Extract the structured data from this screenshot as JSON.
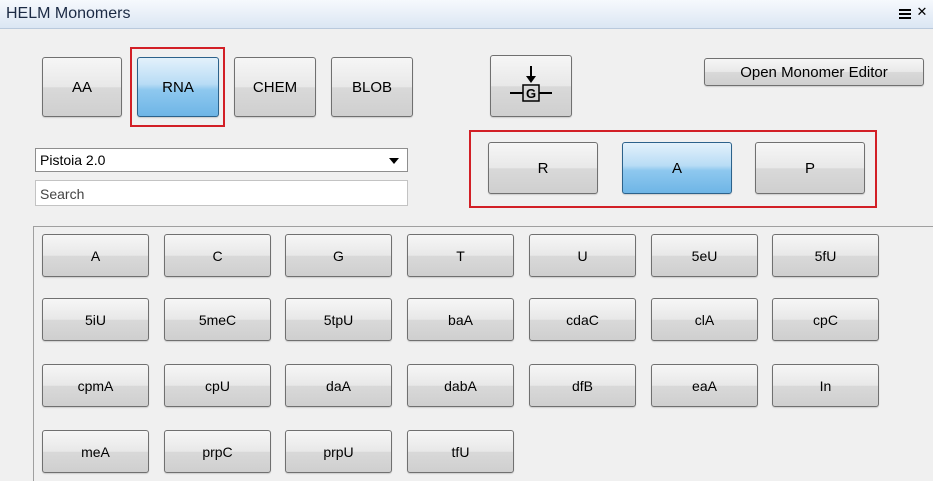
{
  "window": {
    "title": "HELM Monomers"
  },
  "polymer_types": [
    "AA",
    "RNA",
    "CHEM",
    "BLOB"
  ],
  "active_polymer_type": "RNA",
  "insert_icon": "insert-monomer-g-icon",
  "open_editor_label": "Open Monomer Editor",
  "library_select": {
    "value": "Pistoia 2.0"
  },
  "search": {
    "placeholder": "Search"
  },
  "components": [
    "R",
    "A",
    "P"
  ],
  "active_component": "A",
  "monomers": [
    "A",
    "C",
    "G",
    "T",
    "U",
    "5eU",
    "5fU",
    "5iU",
    "5meC",
    "5tpU",
    "baA",
    "cdaC",
    "clA",
    "cpC",
    "cpmA",
    "cpU",
    "daA",
    "dabA",
    "dfB",
    "eaA",
    "In",
    "meA",
    "prpC",
    "prpU",
    "tfU"
  ],
  "colors": {
    "highlight": "#d21f26",
    "active_button": "#8ec8ef"
  }
}
